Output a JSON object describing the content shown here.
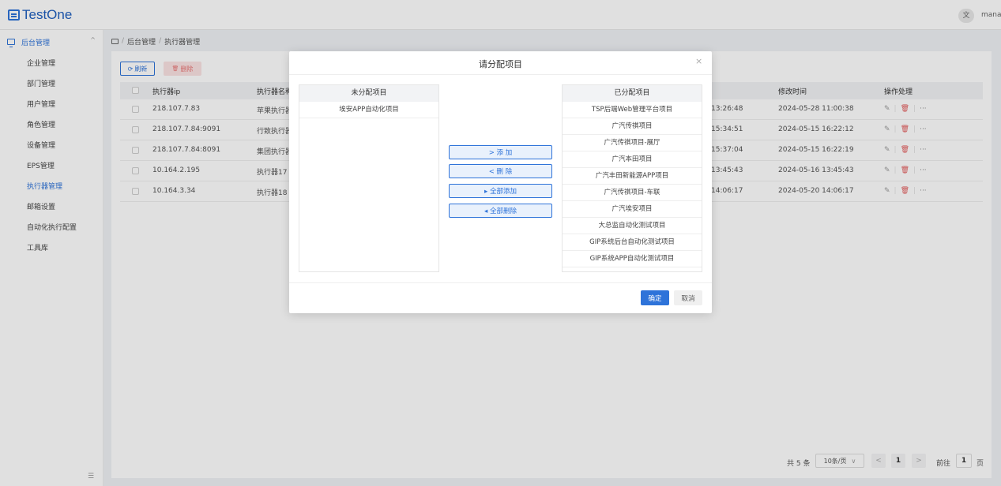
{
  "app": {
    "logo": "TestOne",
    "header_btn": "文",
    "user": "mana"
  },
  "sidebar": {
    "root": "后台管理",
    "root_chevron": "^",
    "items": [
      "企业管理",
      "部门管理",
      "用户管理",
      "角色管理",
      "设备管理",
      "EPS管理",
      "执行器管理",
      "邮箱设置",
      "自动化执行配置",
      "工具库"
    ],
    "active_index": 6,
    "collapse_glyph": "☰"
  },
  "breadcrumb": {
    "sep": "/",
    "items": [
      "后台管理",
      "执行器管理"
    ]
  },
  "toolbar": {
    "refresh_label": "刷新",
    "refresh_icon": "⟳",
    "delete_label": "删除",
    "delete_icon": "🗑"
  },
  "table": {
    "columns": [
      "执行器ip",
      "执行器名称",
      "修改时间",
      "操作处理"
    ],
    "rows": [
      {
        "ip": "218.107.7.83",
        "name": "苹果执行器",
        "created": "13:26:48",
        "modified": "2024-05-28 11:00:38"
      },
      {
        "ip": "218.107.7.84:9091",
        "name": "行致执行器",
        "created": "15:34:51",
        "modified": "2024-05-15 16:22:12"
      },
      {
        "ip": "218.107.7.84:8091",
        "name": "集团执行器",
        "created": "15:37:04",
        "modified": "2024-05-15 16:22:19"
      },
      {
        "ip": "10.164.2.195",
        "name": "执行器17",
        "created": "13:45:43",
        "modified": "2024-05-16 13:45:43"
      },
      {
        "ip": "10.164.3.34",
        "name": "执行器18",
        "created": "14:06:17",
        "modified": "2024-05-20 14:06:17"
      }
    ],
    "op_edit_icon": "✎",
    "op_delete_icon": "🗑",
    "op_more": "···",
    "op_sep": "|"
  },
  "pagination": {
    "total": "共 5 条",
    "size": "10条/页",
    "size_chevron": "∨",
    "prev": "<",
    "page": "1",
    "next": ">",
    "goto_label": "前往",
    "goto_value": "1",
    "page_unit": "页"
  },
  "modal": {
    "title": "请分配项目",
    "close": "×",
    "left_title": "未分配项目",
    "left_items": [
      "埃安APP自动化项目"
    ],
    "right_title": "已分配项目",
    "right_items": [
      "TSP后端Web管理平台项目",
      "广汽传祺项目",
      "广汽传祺项目-展厅",
      "广汽本田项目",
      "广汽丰田新能源APP项目",
      "广汽传祺项目-车联",
      "广汽埃安项目",
      "大总监自动化测试项目",
      "GIP系统后台自动化测试项目",
      "GIP系统APP自动化测试项目"
    ],
    "buttons": {
      "add": "> 添 加",
      "remove": "< 删 除",
      "add_all": "▸ 全部添加",
      "remove_all": "◂ 全部删除"
    },
    "ok": "确定",
    "cancel": "取消"
  }
}
